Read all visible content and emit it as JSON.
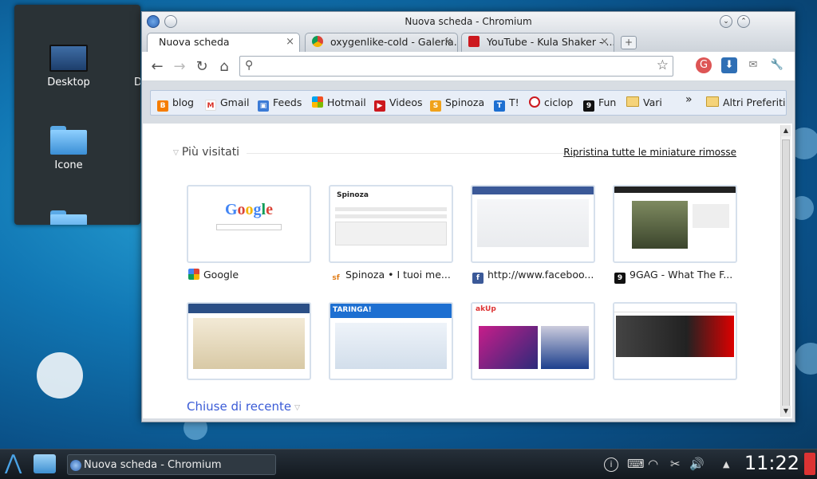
{
  "desktop": {
    "icons": [
      {
        "label": "Desktop"
      },
      {
        "label": "Icone"
      }
    ],
    "peek_label": "D"
  },
  "window": {
    "title": "Nuova scheda - Chromium",
    "tabs": [
      {
        "label": "Nuova scheda",
        "active": true
      },
      {
        "label": "oxygenlike-cold - Galería...",
        "active": false
      },
      {
        "label": "YouTube - Kula Shaker - ...",
        "active": false
      }
    ],
    "omnibox": {
      "value": "",
      "placeholder": ""
    },
    "bookmarks": [
      {
        "label": "blog",
        "icon": "blogger-icon",
        "color": "#f57d00"
      },
      {
        "label": "Gmail",
        "icon": "gmail-icon",
        "color": "#d93025"
      },
      {
        "label": "Feeds",
        "icon": "feeds-icon",
        "color": "#3b7bd6"
      },
      {
        "label": "Hotmail",
        "icon": "windows-icon",
        "color": "#2c9b3c"
      },
      {
        "label": "Videos",
        "icon": "youtube-icon",
        "color": "#cc181e"
      },
      {
        "label": "Spinoza",
        "icon": "spinoza-icon",
        "color": "#f0a21b"
      },
      {
        "label": "T!",
        "icon": "t-icon",
        "color": "#1d6fd1"
      },
      {
        "label": "ciclop",
        "icon": "ciclop-icon",
        "color": "#cc181e"
      },
      {
        "label": "Fun",
        "icon": "9gag-icon",
        "color": "#111111"
      },
      {
        "label": "Vari",
        "icon": "folder-icon",
        "color": "#f5d37a"
      }
    ],
    "bookmarks_overflow": "»",
    "other_bookmarks": "Altri Preferiti",
    "ntp": {
      "most_visited_title": "Più visitati",
      "restore_link": "Ripristina tutte le miniature rimosse",
      "thumbnails": [
        {
          "label": "Google",
          "icon": "google-icon",
          "color": "#4285f4",
          "fav": "G"
        },
        {
          "label": "Spinoza • I tuoi me...",
          "icon": "spinoza-sf-icon",
          "color": "#e07b16",
          "fav": "sf"
        },
        {
          "label": "http://www.faceboo...",
          "icon": "facebook-icon",
          "color": "#3b5998",
          "fav": "f"
        },
        {
          "label": "9GAG - What The F...",
          "icon": "9gag-icon",
          "color": "#111111",
          "fav": "9"
        },
        {
          "label": "",
          "icon": "blogger-icon",
          "color": "#f57d00",
          "fav": ""
        },
        {
          "label": "",
          "icon": "taringa-icon",
          "color": "#1d6fd1",
          "fav": ""
        },
        {
          "label": "",
          "icon": "akup-icon",
          "color": "#d33",
          "fav": ""
        },
        {
          "label": "",
          "icon": "infostrada-icon",
          "color": "#333",
          "fav": ""
        }
      ],
      "recently_closed_title": "Chiuse di recente"
    }
  },
  "taskbar": {
    "task_label": "Nuova scheda - Chromium",
    "clock": "11:22"
  }
}
